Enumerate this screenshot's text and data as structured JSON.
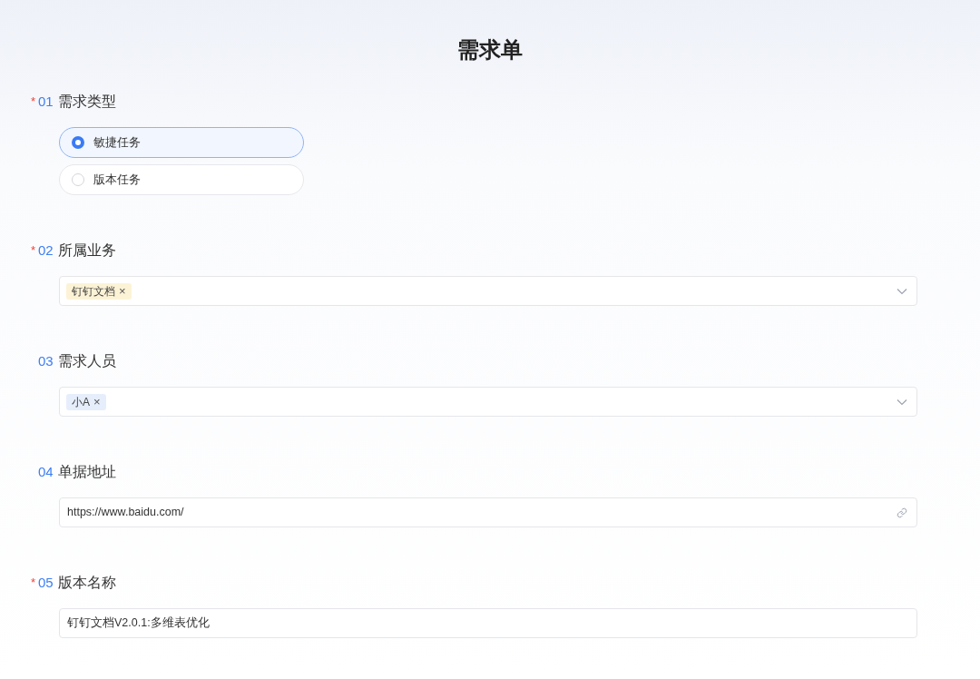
{
  "title": "需求单",
  "questions": [
    {
      "kind": "radio",
      "required_mark": "*",
      "number": "01",
      "label": "需求类型",
      "options": [
        {
          "label": "敏捷任务",
          "selected": true
        },
        {
          "label": "版本任务",
          "selected": false
        }
      ]
    },
    {
      "kind": "select",
      "required_mark": "*",
      "number": "02",
      "label": "所属业务",
      "tags": [
        {
          "label": "钉钉文档",
          "close": "×",
          "color": "#fcf3d6"
        }
      ]
    },
    {
      "kind": "select",
      "number": "03",
      "label": "需求人员",
      "tags": [
        {
          "label": "小A",
          "close": "×",
          "color": "#e6eefc"
        }
      ]
    },
    {
      "kind": "link",
      "number": "04",
      "label": "单据地址",
      "value": "https://www.baidu.com/"
    },
    {
      "kind": "text",
      "required_mark": "*",
      "number": "05",
      "label": "版本名称",
      "value": "钉钉文档V2.0.1:多维表优化"
    }
  ]
}
